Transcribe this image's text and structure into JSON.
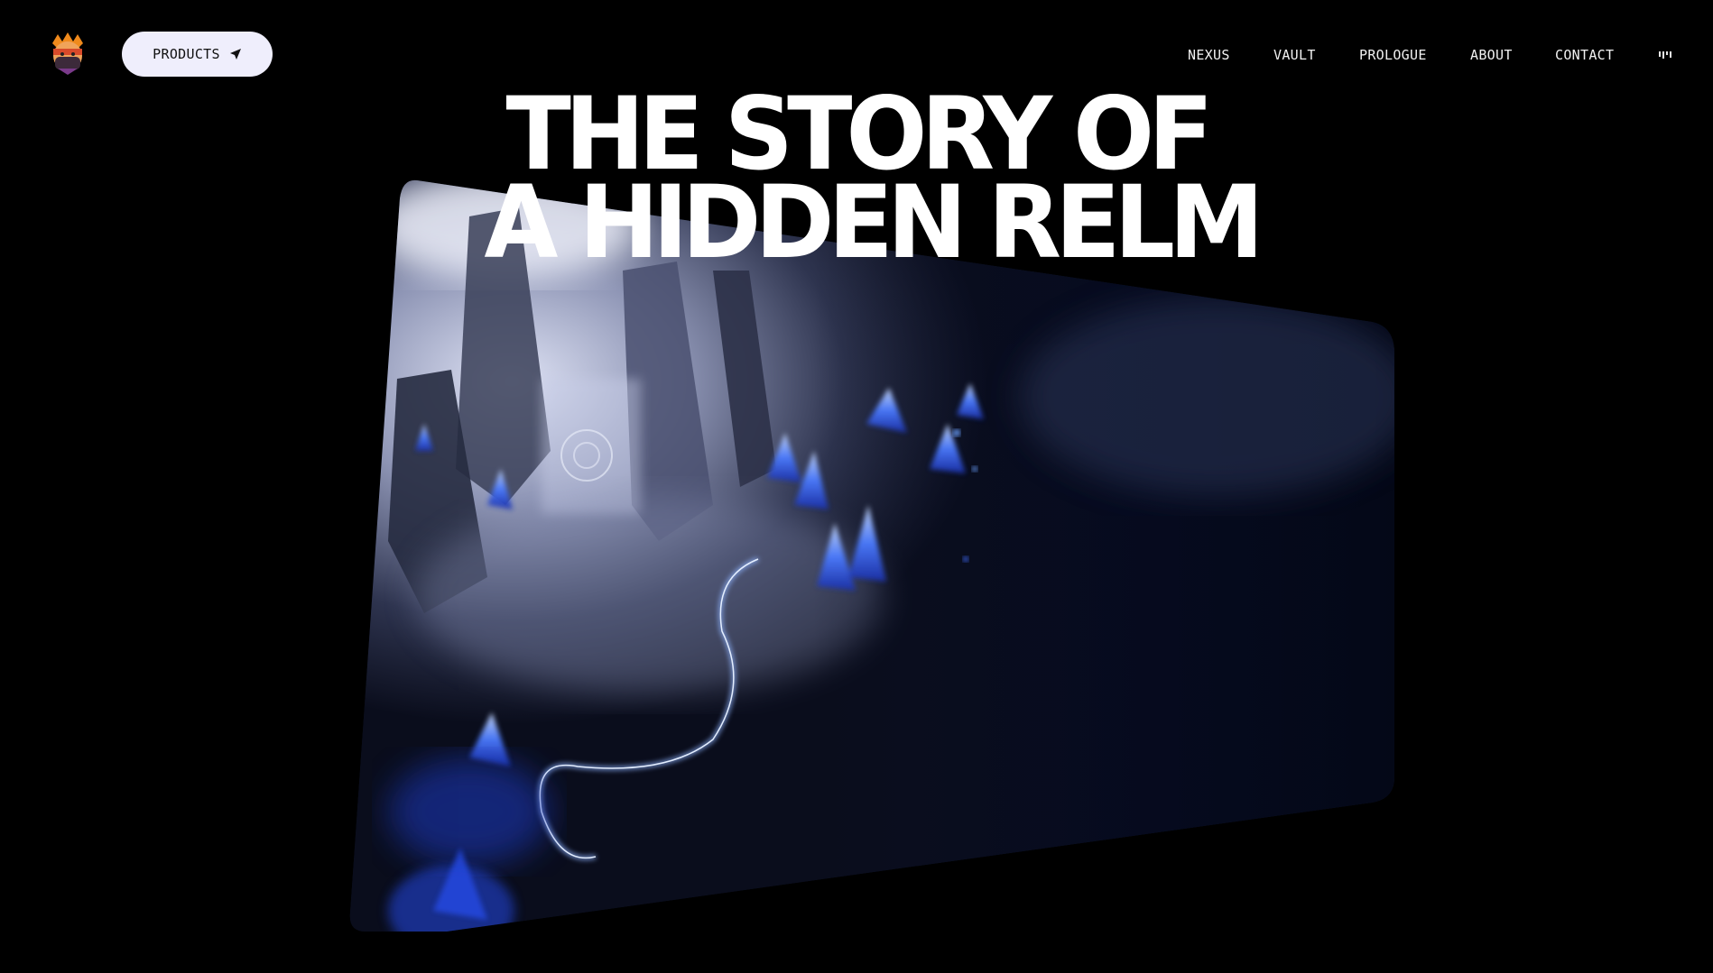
{
  "header": {
    "logo_icon": "ninja-mascot-logo",
    "products_label": "PRODUCTS",
    "products_icon": "send-arrow-icon",
    "nav": [
      "NEXUS",
      "VAULT",
      "PROLOGUE",
      "ABOUT",
      "CONTACT"
    ],
    "audio_icon": "audio-bars-icon"
  },
  "hero": {
    "title_line1": "THE STORY OF",
    "title_line2": "A HIDDEN RELM",
    "image_subject": "crystal-cave-artwork"
  },
  "colors": {
    "background": "#000000",
    "button_bg": "#efeefc",
    "text": "#ffffff",
    "crystal_blue": "#2a5bff"
  }
}
